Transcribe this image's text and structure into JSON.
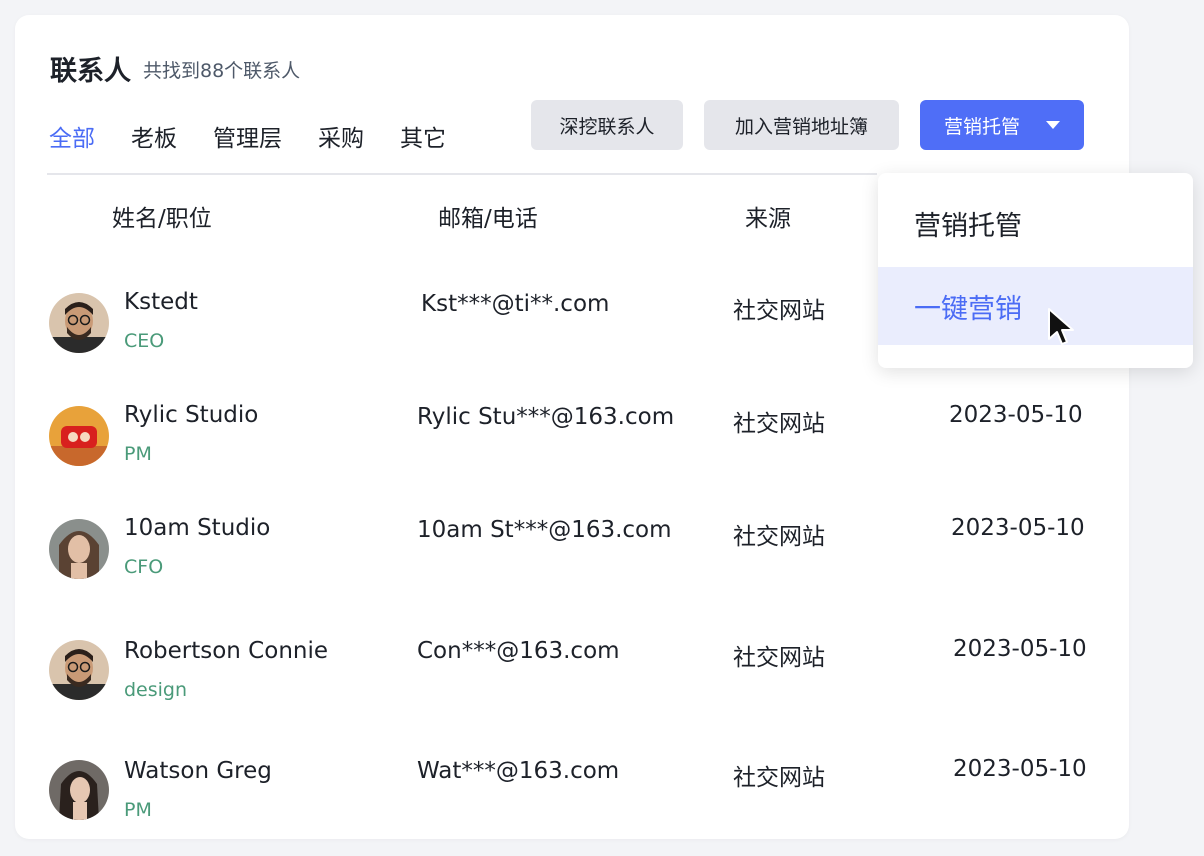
{
  "header": {
    "title": "联系人",
    "subtitle": "共找到88个联系人"
  },
  "tabs": [
    {
      "label": "全部",
      "active": true
    },
    {
      "label": "老板"
    },
    {
      "label": "管理层"
    },
    {
      "label": "采购"
    },
    {
      "label": "其它"
    }
  ],
  "toolbar": {
    "dig_label": "深挖联系人",
    "add_label": "加入营销地址簿",
    "marketing_label": "营销托管"
  },
  "table": {
    "headers": [
      "姓名/职位",
      "邮箱/电话",
      "来源"
    ],
    "rows": [
      {
        "name": "Kstedt",
        "role": "CEO",
        "email": "Kst***@ti**.com",
        "source": "社交网站",
        "date": ""
      },
      {
        "name": "Rylic Studio",
        "role": "PM",
        "email": "Rylic Stu***@163.com",
        "source": "社交网站",
        "date": "2023-05-10"
      },
      {
        "name": "10am Studio",
        "role": "CFO",
        "email": "10am St***@163.com",
        "source": "社交网站",
        "date": "2023-05-10"
      },
      {
        "name": "Robertson Connie",
        "role": "design",
        "email": "Con***@163.com",
        "source": "社交网站",
        "date": "2023-05-10"
      },
      {
        "name": "Watson Greg",
        "role": "PM",
        "email": "Wat***@163.com",
        "source": "社交网站",
        "date": "2023-05-10"
      }
    ]
  },
  "dropdown": {
    "items": [
      {
        "label": "营销托管"
      },
      {
        "label": "一键营销",
        "hovered": true
      }
    ]
  },
  "colors": {
    "accent": "#4f6ef7",
    "role_text": "#4a9a79",
    "hover_bg": "#eaedfd"
  }
}
